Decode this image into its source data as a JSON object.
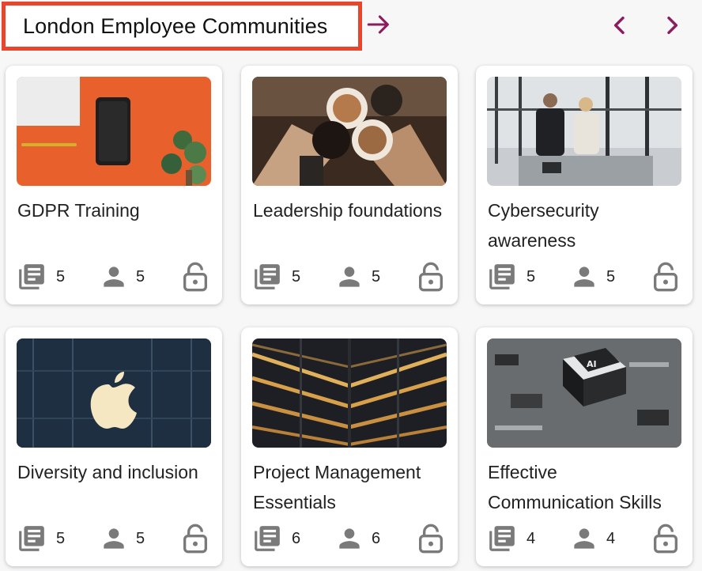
{
  "header": {
    "title": "London Employee Communities",
    "accent_color": "#8b1c5e",
    "highlight_color": "#e8452c",
    "icons": {
      "title_arrow": "arrow-right-icon",
      "prev": "chevron-left-icon",
      "next": "chevron-right-icon"
    }
  },
  "cards": [
    {
      "title": "GDPR Training",
      "courses": "5",
      "members": "5",
      "image": "orange desk with phone and plant"
    },
    {
      "title": "Leadership foundations",
      "courses": "5",
      "members": "5",
      "image": "hands toasting coffee cups"
    },
    {
      "title": "Cybersecurity awareness",
      "courses": "5",
      "members": "5",
      "image": "two people at table in office"
    },
    {
      "title": "Diversity and inclusion",
      "courses": "5",
      "members": "5",
      "image": "apple logo on glass building"
    },
    {
      "title": "Project Management Essentials",
      "courses": "6",
      "members": "6",
      "image": "atrium with lit floors"
    },
    {
      "title": "Effective Communication Skills",
      "courses": "4",
      "members": "4",
      "image": "AI chip on circuit board"
    }
  ],
  "stat_icons": {
    "courses": "library-books-icon",
    "members": "person-icon",
    "access": "lock-open-icon"
  },
  "icon_color": "#7a7a7a"
}
